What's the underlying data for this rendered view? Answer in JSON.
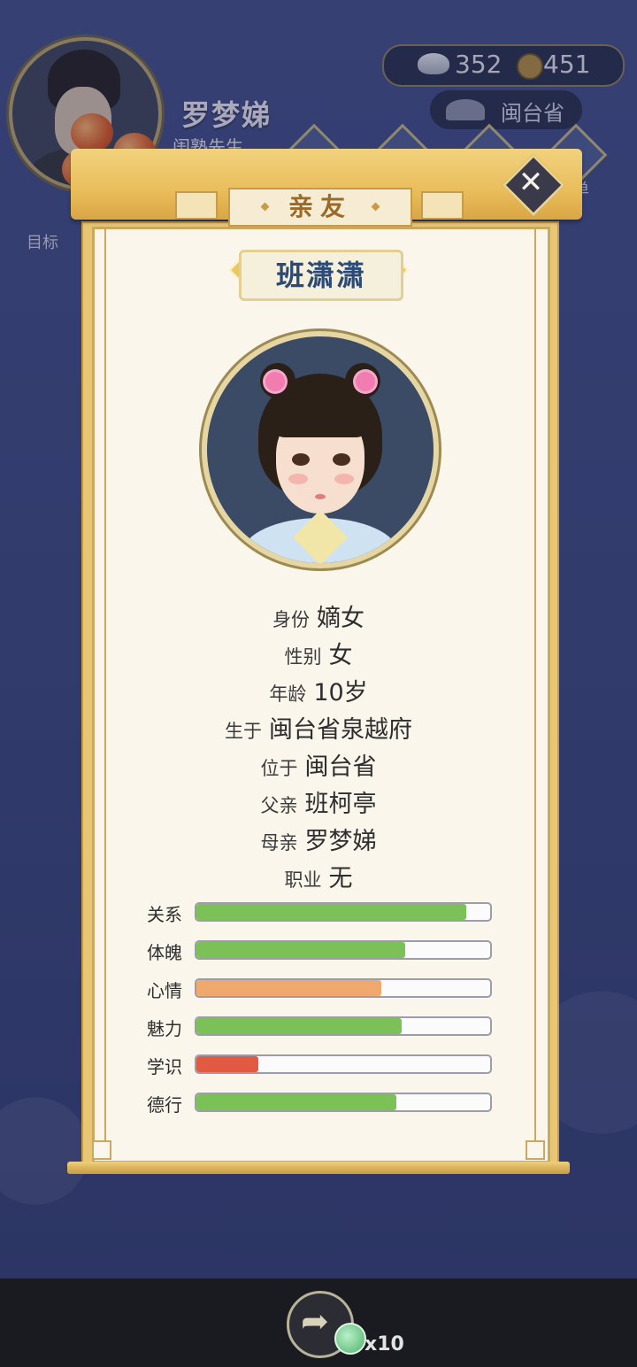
{
  "hud": {
    "player_name": "罗梦娣",
    "player_title": "闺塾先生",
    "goal_label": "目标",
    "silver": "352",
    "copper": "451",
    "province": "闽台省",
    "menu_label": "菜单"
  },
  "dialog": {
    "title": "亲友",
    "character_name": "班潇潇",
    "info": [
      {
        "label": "身份",
        "value": "嫡女"
      },
      {
        "label": "性别",
        "value": "女"
      },
      {
        "label": "年龄",
        "value": "10岁"
      },
      {
        "label": "生于",
        "value": "闽台省泉越府"
      },
      {
        "label": "位于",
        "value": "闽台省"
      },
      {
        "label": "父亲",
        "value": "班柯亭"
      },
      {
        "label": "母亲",
        "value": "罗梦娣"
      },
      {
        "label": "职业",
        "value": "无"
      }
    ],
    "stats": [
      {
        "label": "关系",
        "fraction": 0.92,
        "color": "#7cc157"
      },
      {
        "label": "体魄",
        "fraction": 0.71,
        "color": "#7cc157"
      },
      {
        "label": "心情",
        "fraction": 0.63,
        "color": "#f0a96c"
      },
      {
        "label": "魅力",
        "fraction": 0.7,
        "color": "#7cc157"
      },
      {
        "label": "学识",
        "fraction": 0.21,
        "color": "#e35a43"
      },
      {
        "label": "德行",
        "fraction": 0.68,
        "color": "#7cc157"
      }
    ]
  },
  "footer": {
    "multiplier": "x10"
  }
}
